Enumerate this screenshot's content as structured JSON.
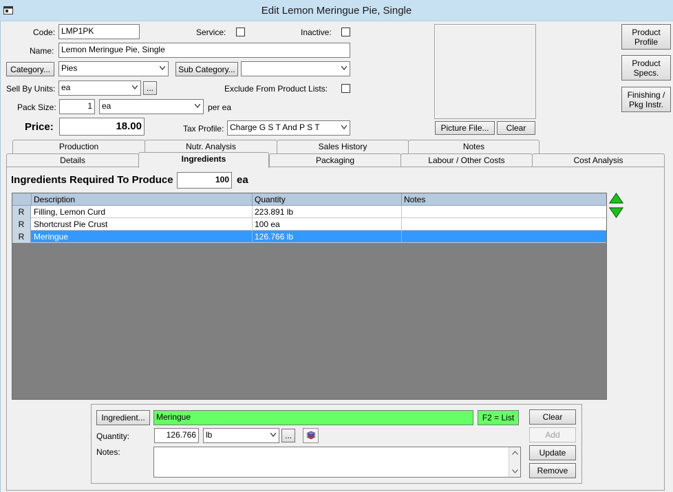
{
  "window": {
    "title": "Edit Lemon Meringue Pie, Single"
  },
  "header": {
    "code_label": "Code:",
    "code_value": "LMP1PK",
    "service_label": "Service:",
    "inactive_label": "Inactive:",
    "name_label": "Name:",
    "name_value": "Lemon Meringue Pie, Single",
    "category_button": "Category...",
    "category_value": "Pies",
    "subcategory_button": "Sub Category...",
    "subcategory_value": "",
    "sell_by_label": "Sell By Units:",
    "sell_by_value": "ea",
    "sell_by_ellipsis": "...",
    "exclude_label": "Exclude From Product Lists:",
    "pack_size_label": "Pack Size:",
    "pack_size_value": "1",
    "pack_unit_value": "ea",
    "per_label": "per ea",
    "price_label": "Price:",
    "price_value": "18.00",
    "tax_label": "Tax Profile:",
    "tax_value": "Charge G S T And P S T"
  },
  "picture": {
    "file_button": "Picture File...",
    "clear_button": "Clear"
  },
  "side_buttons": {
    "profile_line1": "Product",
    "profile_line2": "Profile",
    "specs_line1": "Product",
    "specs_line2": "Specs.",
    "finishing_line1": "Finishing /",
    "finishing_line2": "Pkg Instr."
  },
  "tabs_back": [
    "Production",
    "Nutr. Analysis",
    "Sales History",
    "Notes"
  ],
  "tabs_front": [
    "Details",
    "Ingredients",
    "Packaging",
    "Labour / Other Costs",
    "Cost Analysis"
  ],
  "ingredients": {
    "produce_label": "Ingredients Required To Produce",
    "produce_value": "100",
    "produce_unit": "ea",
    "columns": [
      "Description",
      "Quantity",
      "Notes"
    ],
    "rows": [
      {
        "marker": "R",
        "description": "Filling, Lemon Curd",
        "quantity": "223.891 lb",
        "notes": ""
      },
      {
        "marker": "R",
        "description": "Shortcrust Pie Crust",
        "quantity": "100 ea",
        "notes": ""
      },
      {
        "marker": "R",
        "description": "Meringue",
        "quantity": "126.766 lb",
        "notes": ""
      }
    ],
    "selected_row": 2
  },
  "editor": {
    "ingredient_button": "Ingredient...",
    "ingredient_value": "Meringue",
    "f2_hint": "F2 = List",
    "quantity_label": "Quantity:",
    "quantity_value": "126.766",
    "unit_value": "lb",
    "unit_ellipsis": "...",
    "notes_label": "Notes:",
    "notes_value": "",
    "clear_button": "Clear",
    "add_button": "Add",
    "update_button": "Update",
    "remove_button": "Remove"
  },
  "colors": {
    "titlebar": "#c7e0f2",
    "selection": "#3399ff",
    "highlight_field": "#66ff66",
    "grid_bg": "#808080"
  }
}
